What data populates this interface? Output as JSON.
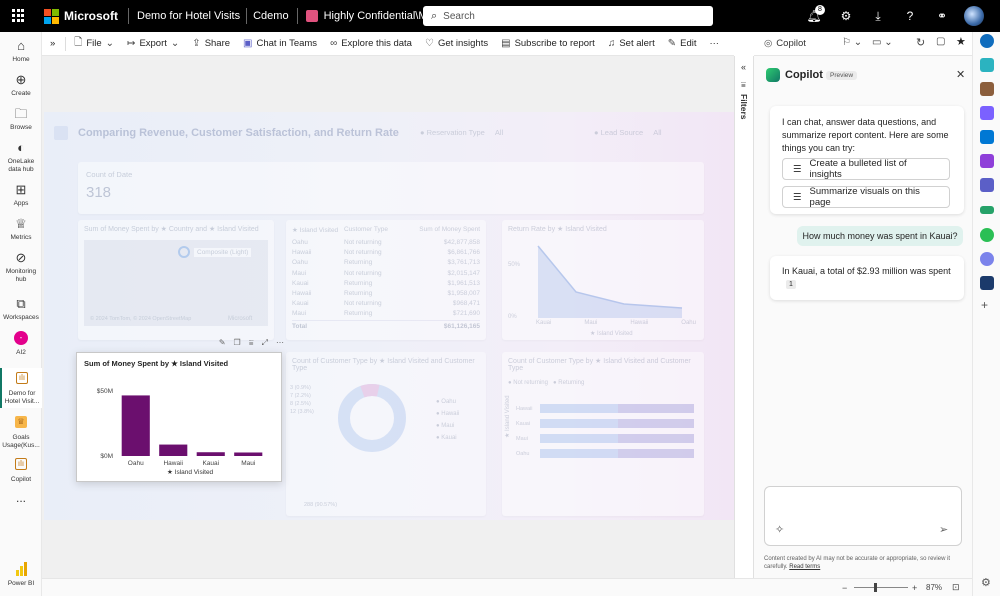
{
  "topbar": {
    "brand": "Microsoft",
    "report_name": "Demo for Hotel Visits",
    "workspace": "Cdemo",
    "sensitivity": "Highly Confidential\\Microsoft FTE",
    "search_placeholder": "Search",
    "notification_count": "8"
  },
  "leftnav": {
    "items": [
      {
        "icon": "home-icon",
        "label": "Home"
      },
      {
        "icon": "plus-circle-icon",
        "label": "Create"
      },
      {
        "icon": "folder-icon",
        "label": "Browse"
      },
      {
        "icon": "onelake-icon",
        "label": "OneLake data hub"
      },
      {
        "icon": "apps-icon",
        "label": "Apps"
      },
      {
        "icon": "trophy-icon",
        "label": "Metrics"
      },
      {
        "icon": "monitor-icon",
        "label": "Monitoring hub"
      },
      {
        "icon": "workspaces-icon",
        "label": "Workspaces"
      },
      {
        "icon": "ai2-icon",
        "label": "AI2"
      },
      {
        "icon": "report-icon",
        "label": "Demo for Hotel Visit..."
      },
      {
        "icon": "goals-icon",
        "label": "Goals Usage(Kus..."
      },
      {
        "icon": "copilot-report-icon",
        "label": "Copilot"
      },
      {
        "icon": "more-icon",
        "label": "..."
      }
    ],
    "product": "Power BI"
  },
  "toolbar": {
    "file": "File",
    "export": "Export",
    "share": "Share",
    "chat_in_teams": "Chat in Teams",
    "explore": "Explore this data",
    "get_insights": "Get insights",
    "subscribe": "Subscribe to report",
    "set_alert": "Set alert",
    "edit": "Edit",
    "more": "···"
  },
  "report": {
    "title": "Comparing Revenue, Customer Satisfaction, and Return Rate",
    "slicer_reservation": "Reservation Type",
    "slicer_reservation_value": "All",
    "slicer_lead": "Lead Source",
    "slicer_lead_value": "All",
    "count_of_date_label": "Count of Date",
    "count_of_date_value": "318",
    "map_title": "Sum of Money Spent by ★ Country and ★ Island Visited",
    "map_tooltip": "Composite (Light)",
    "map_footer": "© 2024 TomTom, © 2024 OpenStreetMap",
    "map_brand": "Microsoft",
    "table_headers": [
      "★ Island Visited",
      "Customer Type",
      "Sum of Money Spent"
    ],
    "table_rows": [
      [
        "Oahu",
        "Not returning",
        "$42,877,858"
      ],
      [
        "Hawaii",
        "Not returning",
        "$6,861,766"
      ],
      [
        "Oahu",
        "Returning",
        "$3,761,713"
      ],
      [
        "Maui",
        "Not returning",
        "$2,015,147"
      ],
      [
        "Kauai",
        "Returning",
        "$1,961,513"
      ],
      [
        "Hawaii",
        "Returning",
        "$1,958,007"
      ],
      [
        "Kauai",
        "Not returning",
        "$968,471"
      ],
      [
        "Maui",
        "Returning",
        "$721,690"
      ]
    ],
    "table_total_label": "Total",
    "table_total_value": "$61,126,165",
    "return_rate_title": "Return Rate by ★ Island Visited",
    "return_rate_yticks": [
      "50%",
      "0%"
    ],
    "return_rate_xticks": [
      "Kauai",
      "Maui",
      "Hawaii",
      "Oahu"
    ],
    "return_rate_xlabel": "★ Island Visited",
    "donut_title": "Count of Customer Type by ★ Island Visited and Customer Type",
    "donut_labels": [
      "3 (0.9%)",
      "7 (2.2%)",
      "8 (2.5%)",
      "12 (3.8%)"
    ],
    "donut_bottom_label": "288 (90.57%)",
    "donut_legend": [
      "Oahu",
      "Hawaii",
      "Maui",
      "Kauai"
    ],
    "stacked_title": "Count of Customer Type by ★ Island Visited and Customer Type",
    "stacked_legend": [
      "Not returning",
      "Returning"
    ],
    "stacked_ylabel": "★ Island Visited",
    "stacked_rows": [
      "Hawaii",
      "Kauai",
      "Maui",
      "Oahu"
    ]
  },
  "focus_chart": {
    "title": "Sum of Money Spent by ★ Island Visited",
    "xlabel": "★ Island Visited"
  },
  "chart_data": {
    "type": "bar",
    "title": "Sum of Money Spent by ★ Island Visited",
    "categories": [
      "Oahu",
      "Hawaii",
      "Kauai",
      "Maui"
    ],
    "values": [
      46.6,
      8.8,
      2.9,
      2.7
    ],
    "unit": "$M",
    "ylim": [
      0,
      50
    ],
    "yticks": [
      "$50M",
      "$0M"
    ],
    "xlabel": "★ Island Visited",
    "ylabel": "",
    "bar_color": "#6b0f6e",
    "grid": false
  },
  "filters": {
    "label": "Filters"
  },
  "copilot": {
    "header": "Copilot",
    "panel_title": "Copilot",
    "preview_badge": "Preview",
    "intro": "I can chat, answer data questions, and summarize report content. Here are some things you can try:",
    "suggestions": [
      "Create a bulleted list of insights",
      "Summarize visuals on this page"
    ],
    "user_message": "How much money was spent in Kauai?",
    "answer": "In Kauai, a total of $2.93 million was spent",
    "citation": "1",
    "disclaimer": "Content created by AI may not be accurate or appropriate, so review it carefully.",
    "read_terms": "Read terms"
  },
  "statusbar": {
    "zoom": "87%"
  },
  "colors": {
    "accent": "#6b0f6e",
    "brand_blue": "#0f6cbd",
    "copilot_user_bubble": "#e0f2ee"
  }
}
